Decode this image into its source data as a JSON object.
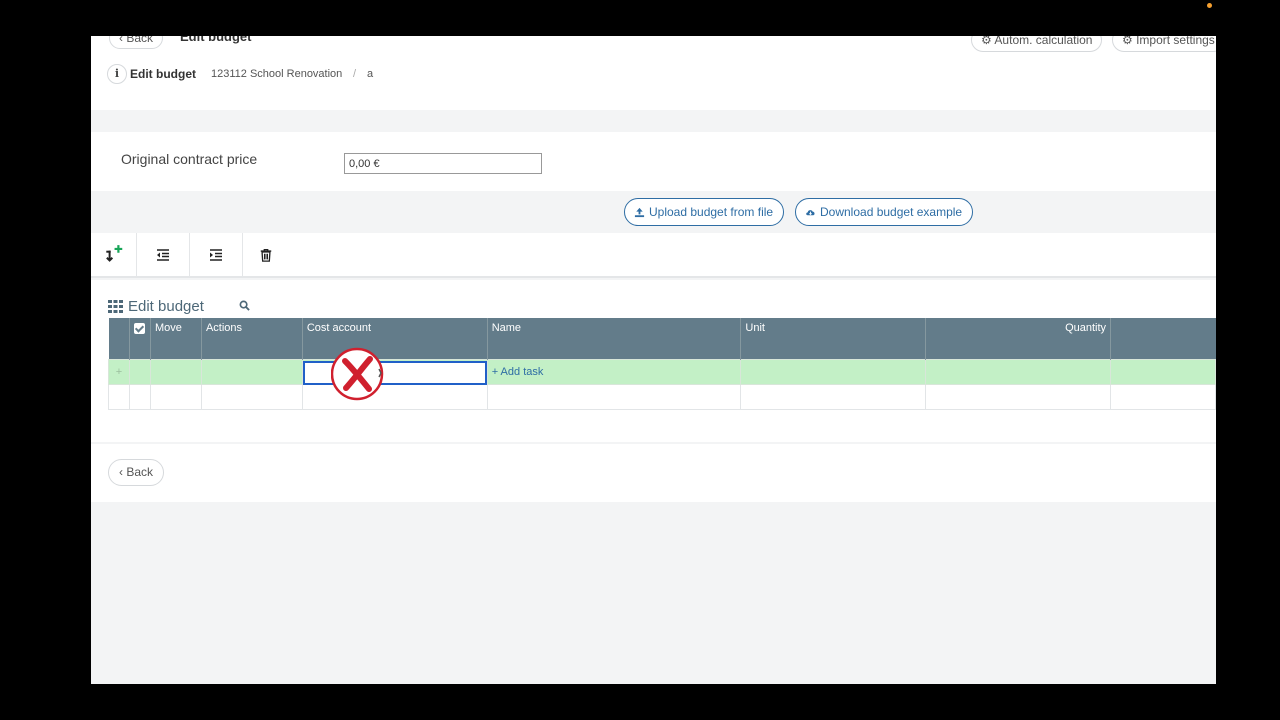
{
  "header": {
    "top_back": "‹ Back",
    "top_title": "Edit budget",
    "autom_calc": "⚙ Autom. calculation",
    "import_settings": "⚙ Import settings",
    "info_icon": "i",
    "title": "Edit budget",
    "project": "123112 School Renovation",
    "separator": "/",
    "leaf": "a"
  },
  "contract": {
    "label": "Original contract price",
    "value": "0,00 €"
  },
  "actions": {
    "upload": "Upload budget from file",
    "download": "Download budget example"
  },
  "toolbar": {
    "icons": [
      "insert-row-icon",
      "outdent-icon",
      "indent-icon",
      "trash-icon"
    ]
  },
  "grid": {
    "title": "Edit budget",
    "columns": [
      "Move",
      "Actions",
      "Cost account",
      "Name",
      "Unit",
      "Quantity"
    ],
    "new_row": {
      "plus": "+",
      "add_task": "+ Add task"
    }
  },
  "footer": {
    "back": "‹ Back"
  },
  "colors": {
    "header_bg": "#637c8a",
    "new_row_bg": "#c3f0c6",
    "accent": "#2e6da4",
    "add_green": "#18a558"
  }
}
